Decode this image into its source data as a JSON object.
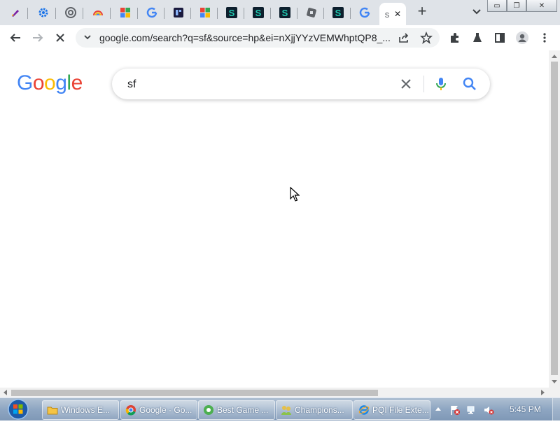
{
  "tabs": [
    {
      "icon": "pen-icon"
    },
    {
      "icon": "gear-icon"
    },
    {
      "icon": "chrome-icon"
    },
    {
      "icon": "rainbow-icon"
    },
    {
      "icon": "multicolor-squares-icon"
    },
    {
      "icon": "google-g-icon"
    },
    {
      "icon": "dark-grid-icon"
    },
    {
      "icon": "multicolor-squares-icon"
    },
    {
      "icon": "s-app-icon"
    },
    {
      "icon": "s-app-icon"
    },
    {
      "icon": "s-app-icon"
    },
    {
      "icon": "cube-icon"
    },
    {
      "icon": "s-app-icon"
    },
    {
      "icon": "google-g-icon"
    }
  ],
  "active_tab": {
    "label": "s"
  },
  "window_controls": {
    "minimize": "▭",
    "restore": "❐",
    "close": "✕"
  },
  "toolbar": {
    "url": "google.com/search?q=sf&source=hp&ei=nXjjYYzVEMWhptQP8_..."
  },
  "google": {
    "logo_letters": [
      {
        "ch": "G",
        "color": "#4285F4"
      },
      {
        "ch": "o",
        "color": "#EA4335"
      },
      {
        "ch": "o",
        "color": "#FBBC05"
      },
      {
        "ch": "g",
        "color": "#4285F4"
      },
      {
        "ch": "l",
        "color": "#34A853"
      },
      {
        "ch": "e",
        "color": "#EA4335"
      }
    ],
    "search_query": "sf"
  },
  "taskbar": {
    "items": [
      {
        "label": "Windows E..."
      },
      {
        "label": "Google - Go..."
      },
      {
        "label": "Best Game ..."
      },
      {
        "label": "Champions..."
      },
      {
        "label": "PQI File Exte..."
      }
    ],
    "clock": "5:45 PM"
  },
  "colors": {
    "google_blue": "#4285F4",
    "google_red": "#EA4335",
    "google_yellow": "#FBBC05",
    "google_green": "#34A853"
  }
}
